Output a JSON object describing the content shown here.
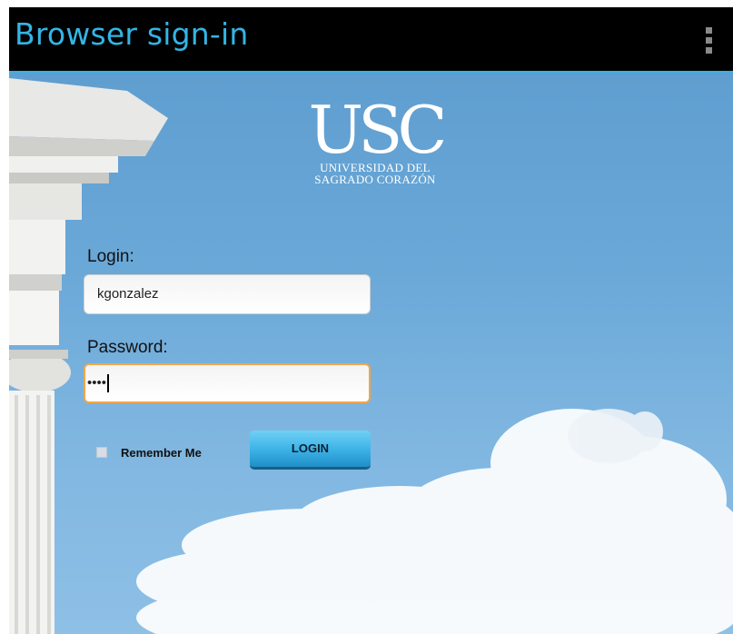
{
  "app": {
    "title": "Browser sign-in"
  },
  "logo": {
    "mark": "USC",
    "line1": "UNIVERSIDAD DEL",
    "line2": "SAGRADO CORAZÓN"
  },
  "form": {
    "login_label": "Login:",
    "login_value": "kgonzalez",
    "password_label": "Password:",
    "password_value": "••••",
    "remember_label": "Remember Me",
    "remember_checked": false,
    "login_button": "LOGIN"
  },
  "colors": {
    "title_accent": "#33b5e5",
    "sky": "#6aa8d8",
    "focus_border": "#f0a64a",
    "button": "#3fb4e8"
  },
  "icons": {
    "overflow_menu": "overflow-menu-icon"
  }
}
